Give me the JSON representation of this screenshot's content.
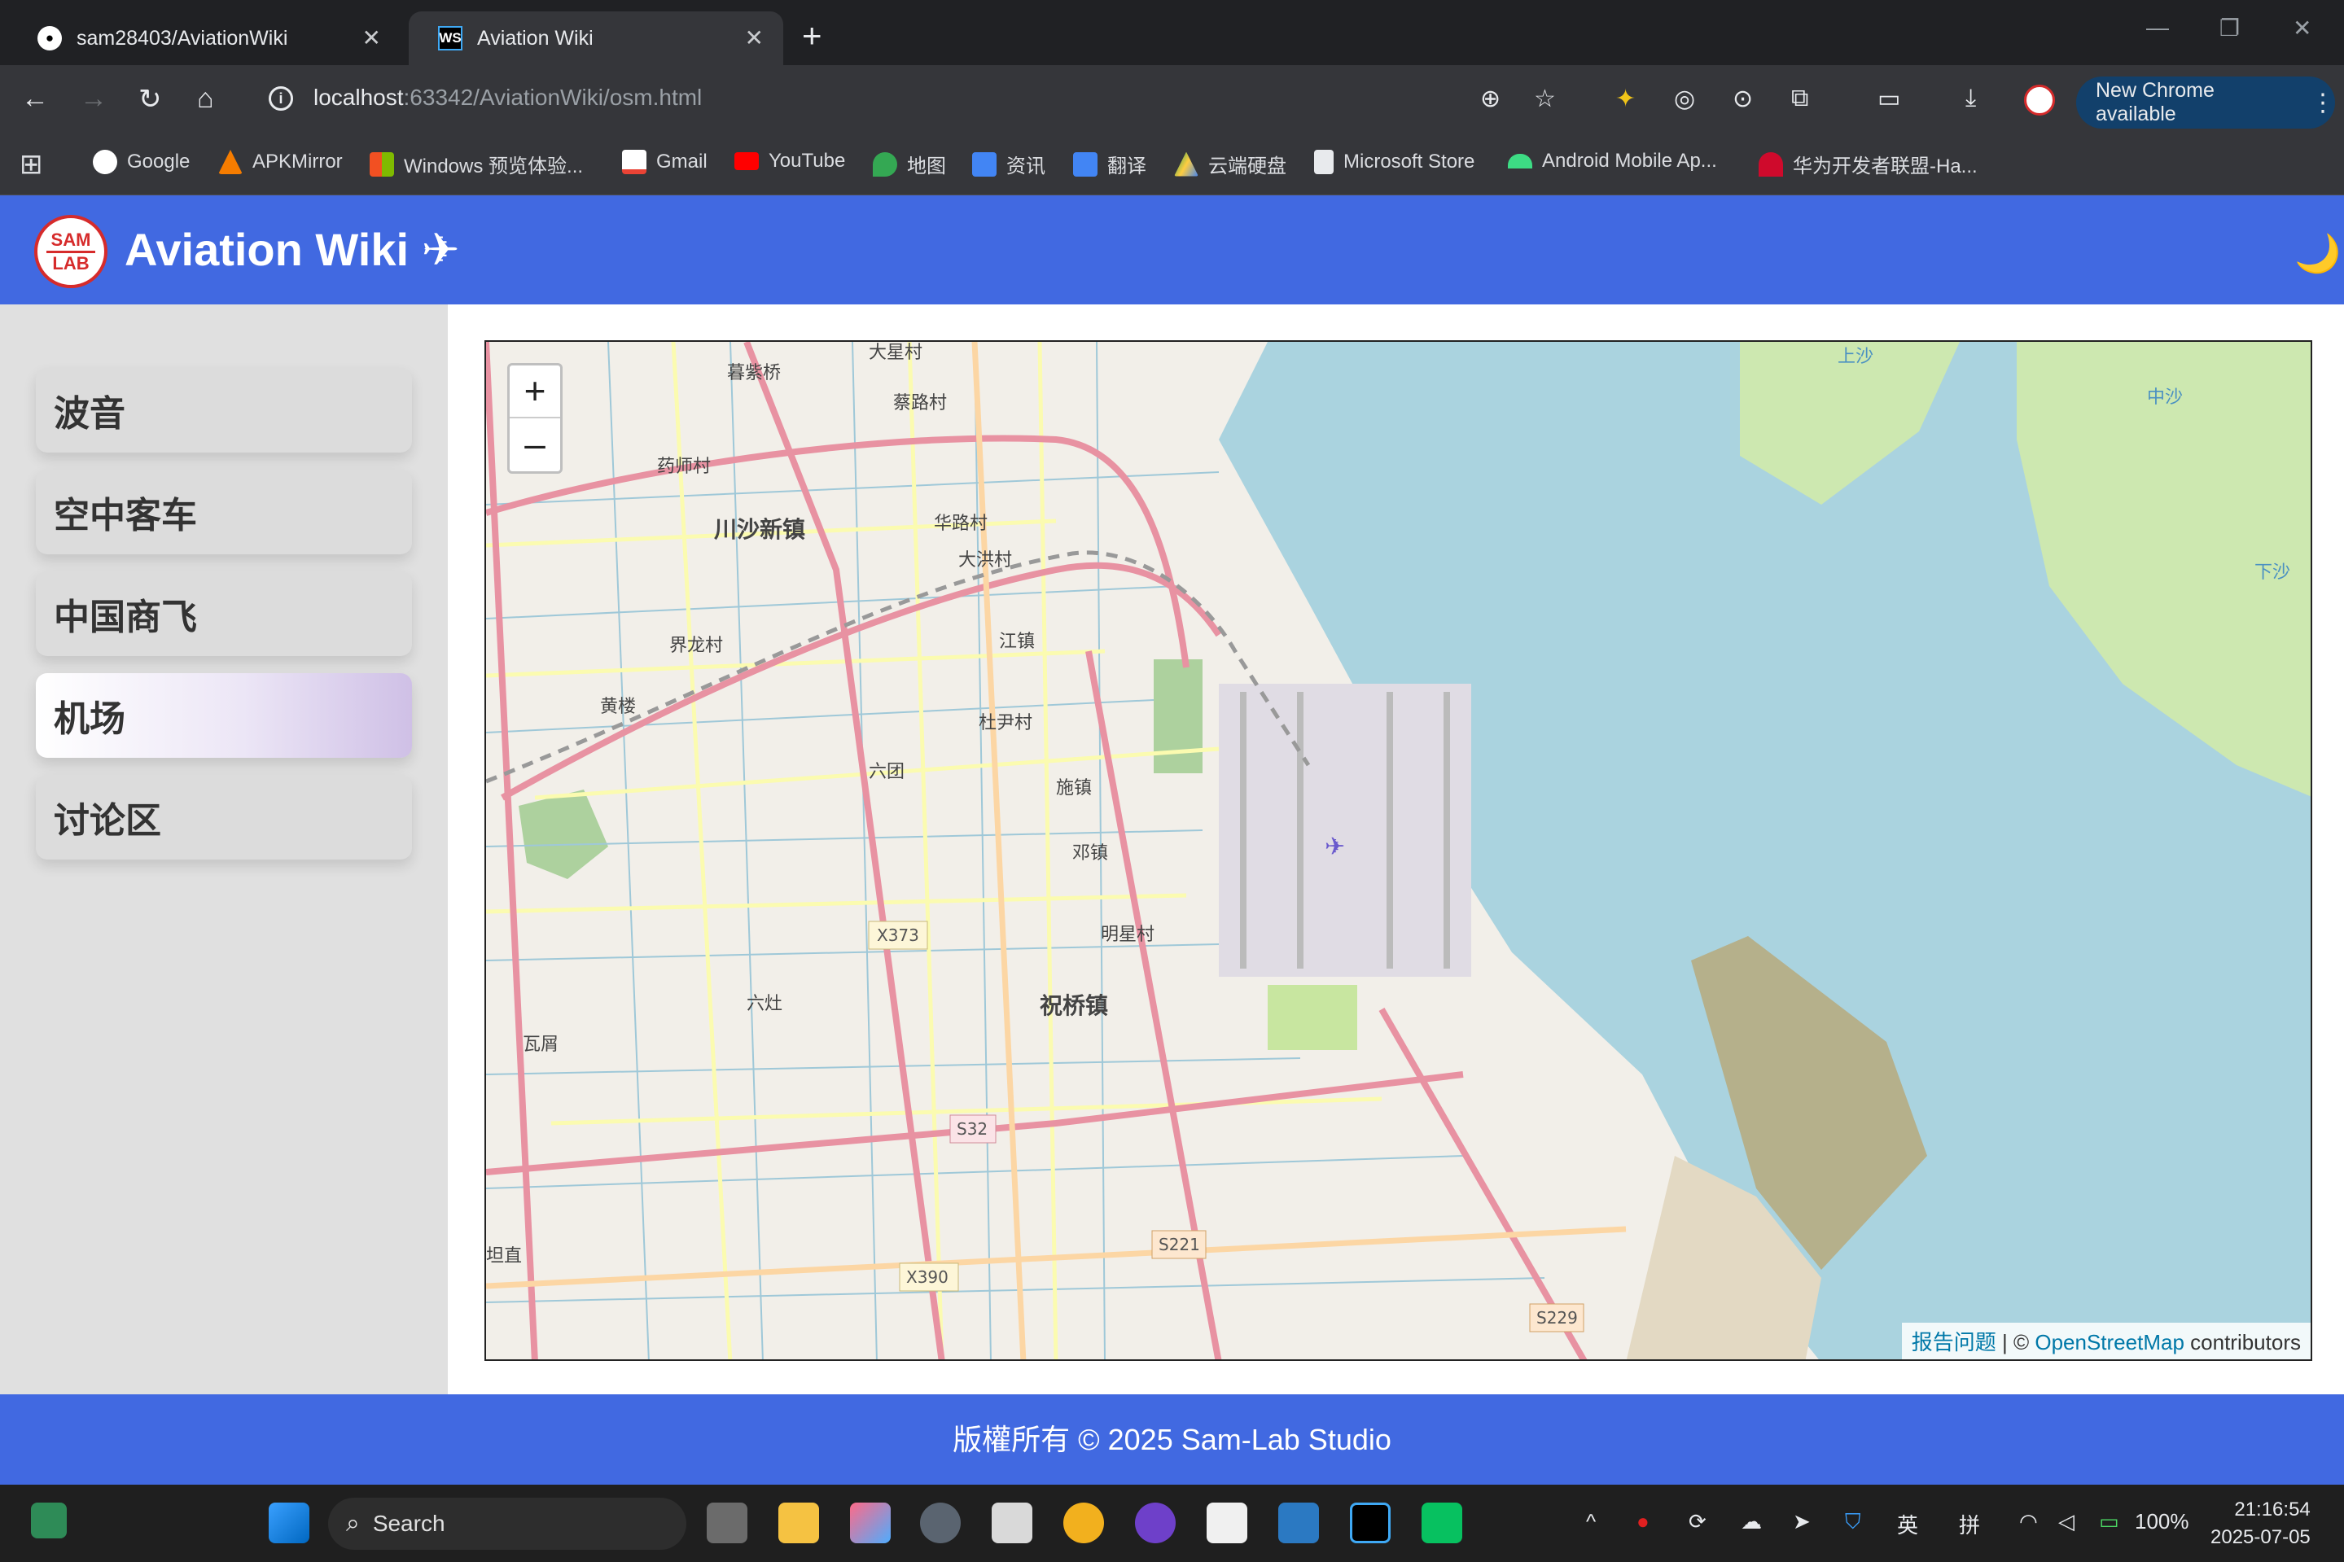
{
  "browser": {
    "tabs": [
      {
        "title": "sam28403/AviationWiki",
        "icon": "github-icon"
      },
      {
        "title": "Aviation Wiki",
        "icon": "webstorm-icon",
        "active": true
      }
    ],
    "url_host": "localhost",
    "url_port": ":63342",
    "url_path": "/AviationWiki/osm.html",
    "update_button": "New Chrome available",
    "bookmarks": [
      "Google",
      "APKMirror",
      "Windows 预览体验...",
      "Gmail",
      "YouTube",
      "地图",
      "资讯",
      "翻译",
      "云端硬盘",
      "Microsoft Store",
      "Android Mobile Ap...",
      "华为开发者联盟-Ha..."
    ]
  },
  "site": {
    "logo_top": "SAM",
    "logo_bottom": "LAB",
    "title": "Aviation Wiki ✈",
    "theme_toggle": "🌙",
    "nav": [
      {
        "label": "波音",
        "active": false
      },
      {
        "label": "空中客车",
        "active": false
      },
      {
        "label": "中国商飞",
        "active": false
      },
      {
        "label": "机场",
        "active": true
      },
      {
        "label": "讨论区",
        "active": false
      }
    ],
    "footer": "版權所有 © 2025 Sam-Lab Studio"
  },
  "map": {
    "zoom_in": "+",
    "zoom_out": "–",
    "attribution_report": "报告问题",
    "attribution_sep": " | © ",
    "attribution_osm": "OpenStreetMap",
    "attribution_tail": " contributors",
    "place_labels": [
      "暮紫桥",
      "大星村",
      "蔡路村",
      "药师村",
      "川沙新镇",
      "华路村",
      "大洪村",
      "界龙村",
      "江镇",
      "黄楼",
      "杜尹村",
      "六团",
      "施镇",
      "邓镇",
      "明星村",
      "六灶",
      "祝桥镇",
      "瓦屑",
      "坦直",
      "上沙",
      "中沙",
      "下沙"
    ],
    "road_labels": [
      "X373",
      "S32",
      "S221",
      "X390",
      "S229"
    ]
  },
  "taskbar": {
    "search_placeholder": "Search",
    "ime_lang": "英",
    "ime_mode": "拼",
    "battery": "100%",
    "time": "21:16:54",
    "date": "2025-07-05"
  },
  "colors": {
    "brand_blue": "#4169e1",
    "water": "#aad3df",
    "land": "#f2efe9"
  }
}
